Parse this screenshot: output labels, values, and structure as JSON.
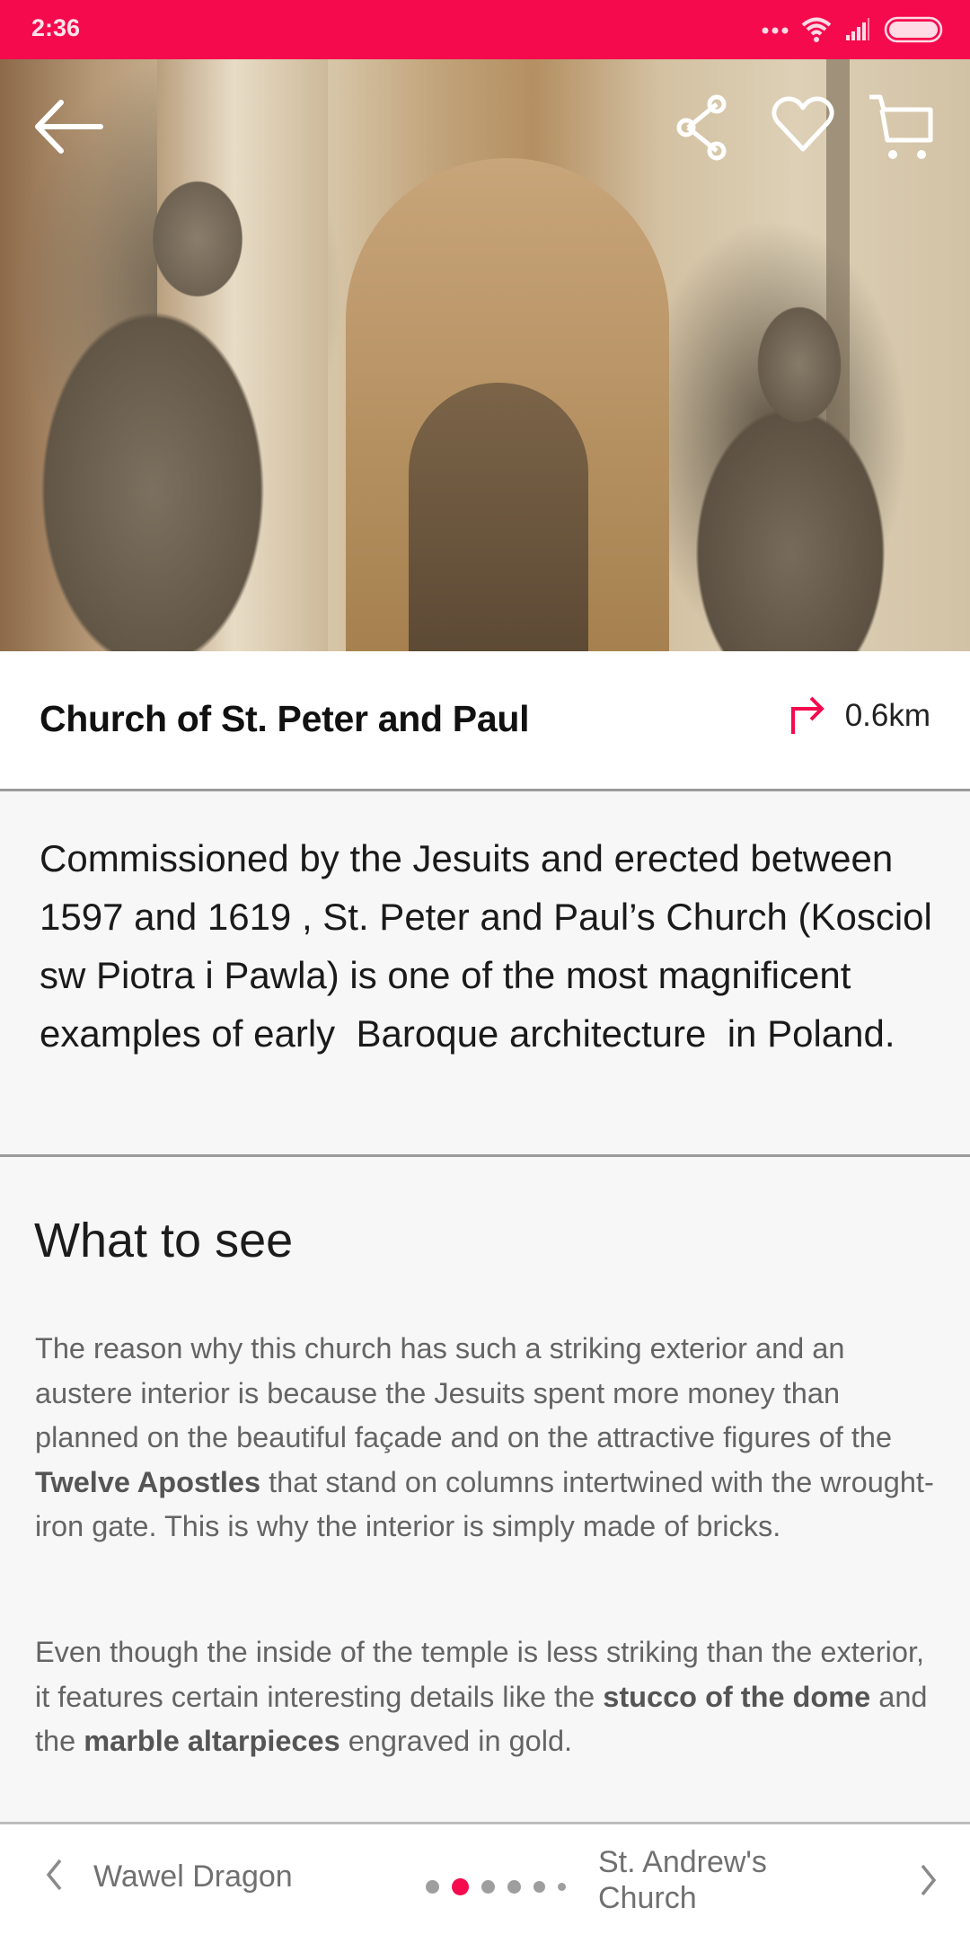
{
  "status_bar": {
    "time": "2:36",
    "icons": [
      "more-dots-icon",
      "wifi-icon",
      "signal-icon",
      "battery-icon"
    ]
  },
  "hero": {
    "image_description": "Baroque stone statues of apostles in front of a church facade",
    "actions": {
      "back": "back-arrow-icon",
      "share": "share-icon",
      "favorite": "heart-icon",
      "cart": "cart-icon"
    }
  },
  "place": {
    "title": "Church of St. Peter and Paul",
    "distance": "0.6km",
    "distance_icon": "directions-turn-icon"
  },
  "intro": {
    "text": "Commissioned by the Jesuits and erected between  1597 and 1619 , St. Peter and Paul’s Church (Kosciol sw Piotra i Pawla) is one of the most magnificent examples of early  Baroque architecture  in Poland."
  },
  "what_to_see": {
    "heading": "What to see",
    "paragraph1": {
      "before": "The reason why this church has such a striking exterior and an austere interior is because the Jesuits spent more money than planned on the beautiful façade and on the attractive figures of the ",
      "bold1": "Twelve Apostles",
      "after": " that stand on columns intertwined with the wrought-iron gate. This is why the interior is simply made of bricks."
    },
    "paragraph2": {
      "before": "Even though the inside of the temple is less striking than the exterior, it features certain interesting details like the ",
      "bold1": "stucco of the dome",
      "middle": " and the ",
      "bold2": "marble altarpieces",
      "after": " engraved in gold."
    }
  },
  "bottom_nav": {
    "prev_label": "Wawel Dragon",
    "next_label": "St. Andrew's Church",
    "page_count_visible": 6,
    "active_page_index": 1
  },
  "colors": {
    "accent": "#f50a4e",
    "divider": "#9b9b9b",
    "body_text": "#646464",
    "dot_inactive": "#9e9e9e"
  }
}
